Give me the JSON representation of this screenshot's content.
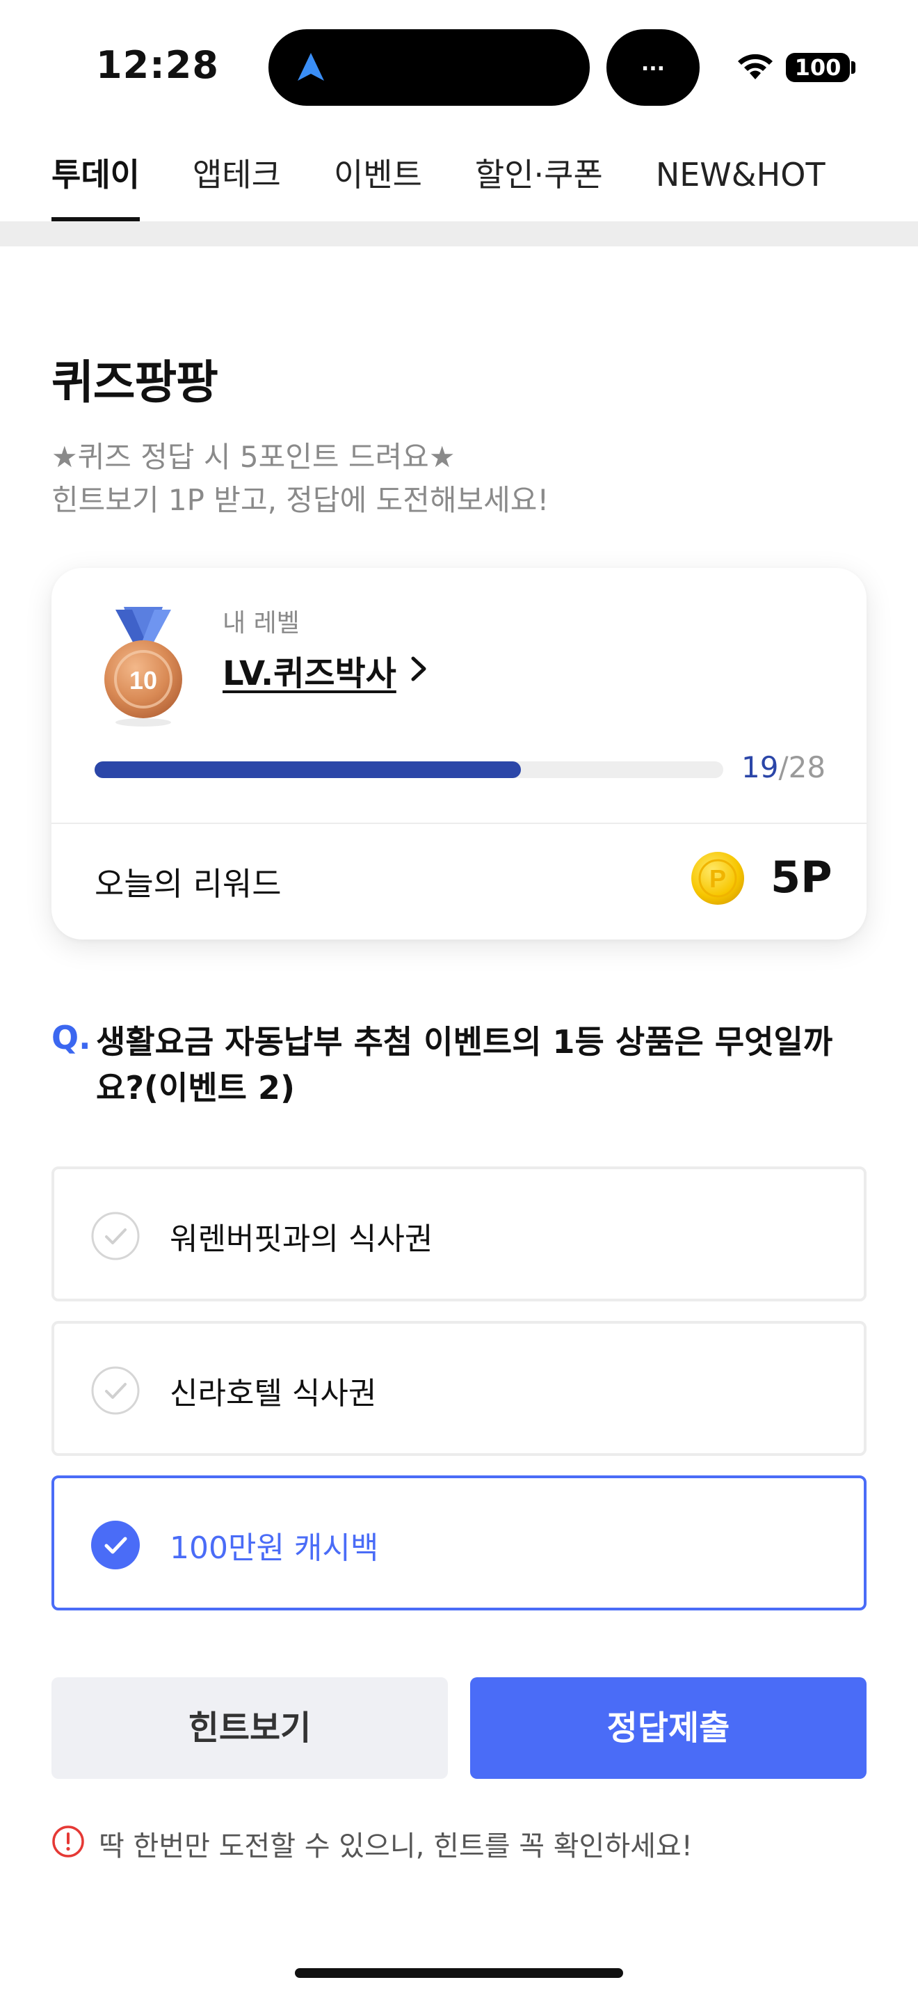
{
  "status_bar": {
    "time": "12:28",
    "more_label": "...",
    "battery": "100",
    "icons": [
      "navigation-arrow-icon",
      "wifi-icon",
      "battery-icon"
    ]
  },
  "tabs": [
    {
      "label": "투데이",
      "active": true
    },
    {
      "label": "앱테크",
      "active": false
    },
    {
      "label": "이벤트",
      "active": false
    },
    {
      "label": "할인·쿠폰",
      "active": false
    },
    {
      "label": "NEW&HOT",
      "active": false
    }
  ],
  "quiz": {
    "title": "퀴즈팡팡",
    "desc_line1": "★퀴즈 정답 시 5포인트 드려요★",
    "desc_line2": "힌트보기 1P 받고, 정답에 도전해보세요!"
  },
  "level_card": {
    "caption": "내 레벨",
    "level_name": "LV.퀴즈박사",
    "medal_number": "10",
    "progress_current": "19",
    "progress_separator": "/",
    "progress_total": "28",
    "progress_fraction": 0.6786,
    "reward_label": "오늘의 리워드",
    "coin_symbol": "P",
    "reward_value": "5P"
  },
  "question": {
    "prefix": "Q.",
    "text": "생활요금 자동납부 추첨 이벤트의 1등 상품은 무엇일까요?(이벤트 2)"
  },
  "options": [
    {
      "label": "워렌버핏과의 식사권",
      "selected": false
    },
    {
      "label": "신라호텔 식사권",
      "selected": false
    },
    {
      "label": "100만원 캐시백",
      "selected": true
    }
  ],
  "buttons": {
    "hint": "힌트보기",
    "submit": "정답제출"
  },
  "notice": {
    "text": "딱 한번만 도전할 수 있으니, 힌트를 꼭 확인하세요!"
  },
  "colors": {
    "accent": "#4a6cf7",
    "progress": "#2b46a8",
    "notice_icon": "#e53935",
    "coin": "#f7c600"
  }
}
